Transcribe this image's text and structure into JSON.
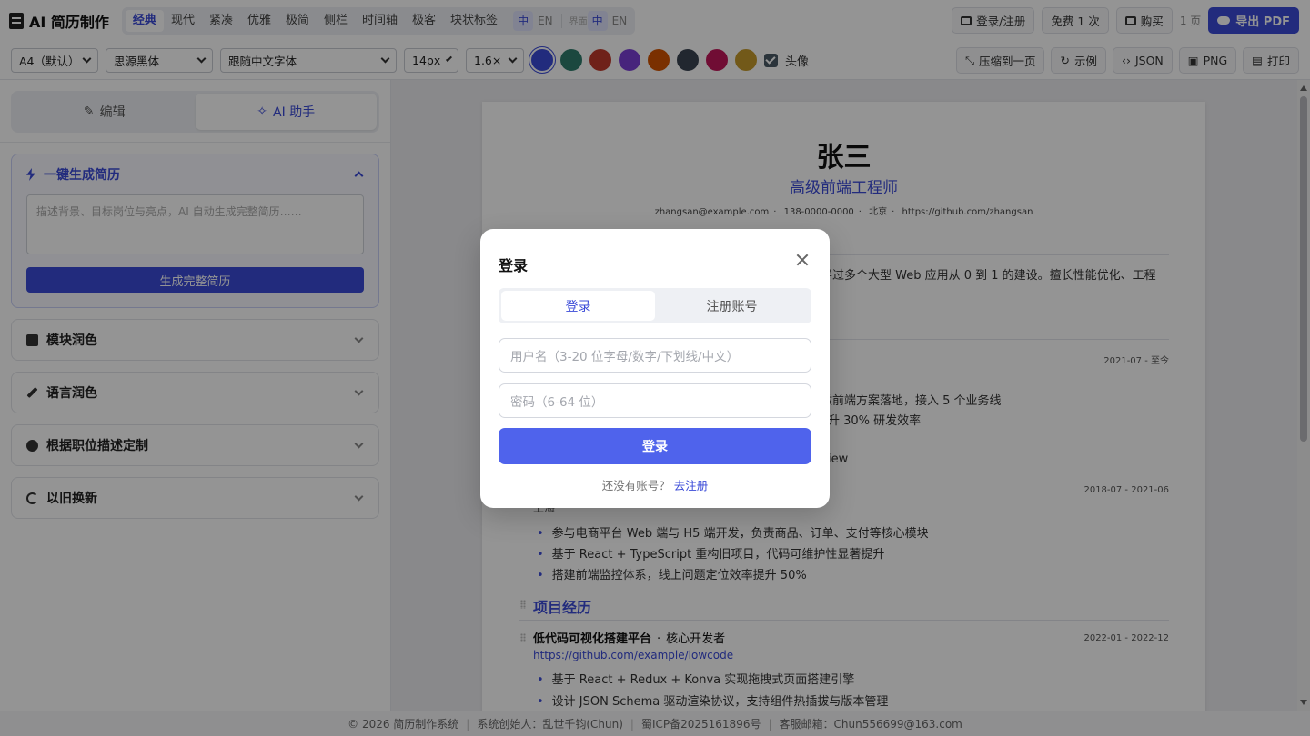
{
  "app": {
    "title": "AI 简历制作"
  },
  "templates": [
    "经典",
    "现代",
    "紧凑",
    "优雅",
    "极简",
    "侧栏",
    "时间轴",
    "极客",
    "块状标签"
  ],
  "active_template": "经典",
  "content_lang": {
    "zh": "中",
    "en": "EN"
  },
  "ui_lang": {
    "label": "界面",
    "zh": "中",
    "en": "EN"
  },
  "header_buttons": {
    "login": "登录/注册",
    "free": "免费 1 次",
    "buy": "购买",
    "pages": "1 页",
    "export": "导出 PDF"
  },
  "toolbar": {
    "paper": "A4（默认）",
    "font": "思源黑体",
    "en_font": "跟随中文字体",
    "size": "14px",
    "line_height": "1.6×",
    "colors": [
      "#3b4bd8",
      "#2f7d6d",
      "#c0392b",
      "#7b3fd6",
      "#d35400",
      "#3a4452",
      "#c2185b",
      "#c49a2c"
    ],
    "avatar_label": "头像",
    "compress": "压缩到一页",
    "example": "示例",
    "json": "JSON",
    "png": "PNG",
    "print": "打印"
  },
  "left": {
    "tab_edit": "编辑",
    "tab_ai": "AI 助手",
    "gen_title": "一键生成简历",
    "gen_placeholder": "描述背景、目标岗位与亮点，AI 自动生成完整简历……",
    "gen_button": "生成完整简历",
    "sections": [
      "模块润色",
      "语言润色",
      "根据职位描述定制",
      "以旧换新"
    ]
  },
  "resume": {
    "name": "张三",
    "title": "高级前端工程师",
    "email": "zhangsan@example.com",
    "phone": "138-0000-0000",
    "city": "北京",
    "github": "https://github.com/zhangsan",
    "summary_tail": "导过多个大型 Web 应用从 0 到 1 的建设。擅长性能优化、工程",
    "job1_date": "2021-07 - 至今",
    "job1_b1": "微前端方案落地，接入 5 个业务线",
    "job1_b2": "升 30% 研发效率",
    "job1_b3": "iew",
    "job2_date": "2018-07 - 2021-06",
    "job2_city": "上海",
    "job2_b1": "参与电商平台 Web 端与 H5 端开发，负责商品、订单、支付等核心模块",
    "job2_b2": "基于 React + TypeScript 重构旧项目，代码可维护性显著提升",
    "job2_b3": "搭建前端监控体系，线上问题定位效率提升 50%",
    "projects_title": "项目经历",
    "proj1_name": "低代码可视化搭建平台",
    "proj1_role": "核心开发者",
    "proj1_date": "2022-01 - 2022-12",
    "proj1_link": "https://github.com/example/lowcode",
    "proj1_b1": "基于 React + Redux + Konva 实现拖拽式页面搭建引擎",
    "proj1_b2": "设计 JSON Schema 驱动渲染协议，支持组件热插拔与版本管理"
  },
  "footer": {
    "copyright": "© 2026 简历制作系统",
    "founder": "系统创始人：乱世千钧(Chun)",
    "icp": "蜀ICP备2025161896号",
    "email": "客服邮箱：Chun556699@163.com"
  },
  "modal": {
    "title": "登录",
    "tab_login": "登录",
    "tab_register": "注册账号",
    "username_placeholder": "用户名（3-20 位字母/数字/下划线/中文）",
    "password_placeholder": "密码（6-64 位）",
    "submit": "登录",
    "no_account": "还没有账号？",
    "go_register": "去注册"
  }
}
